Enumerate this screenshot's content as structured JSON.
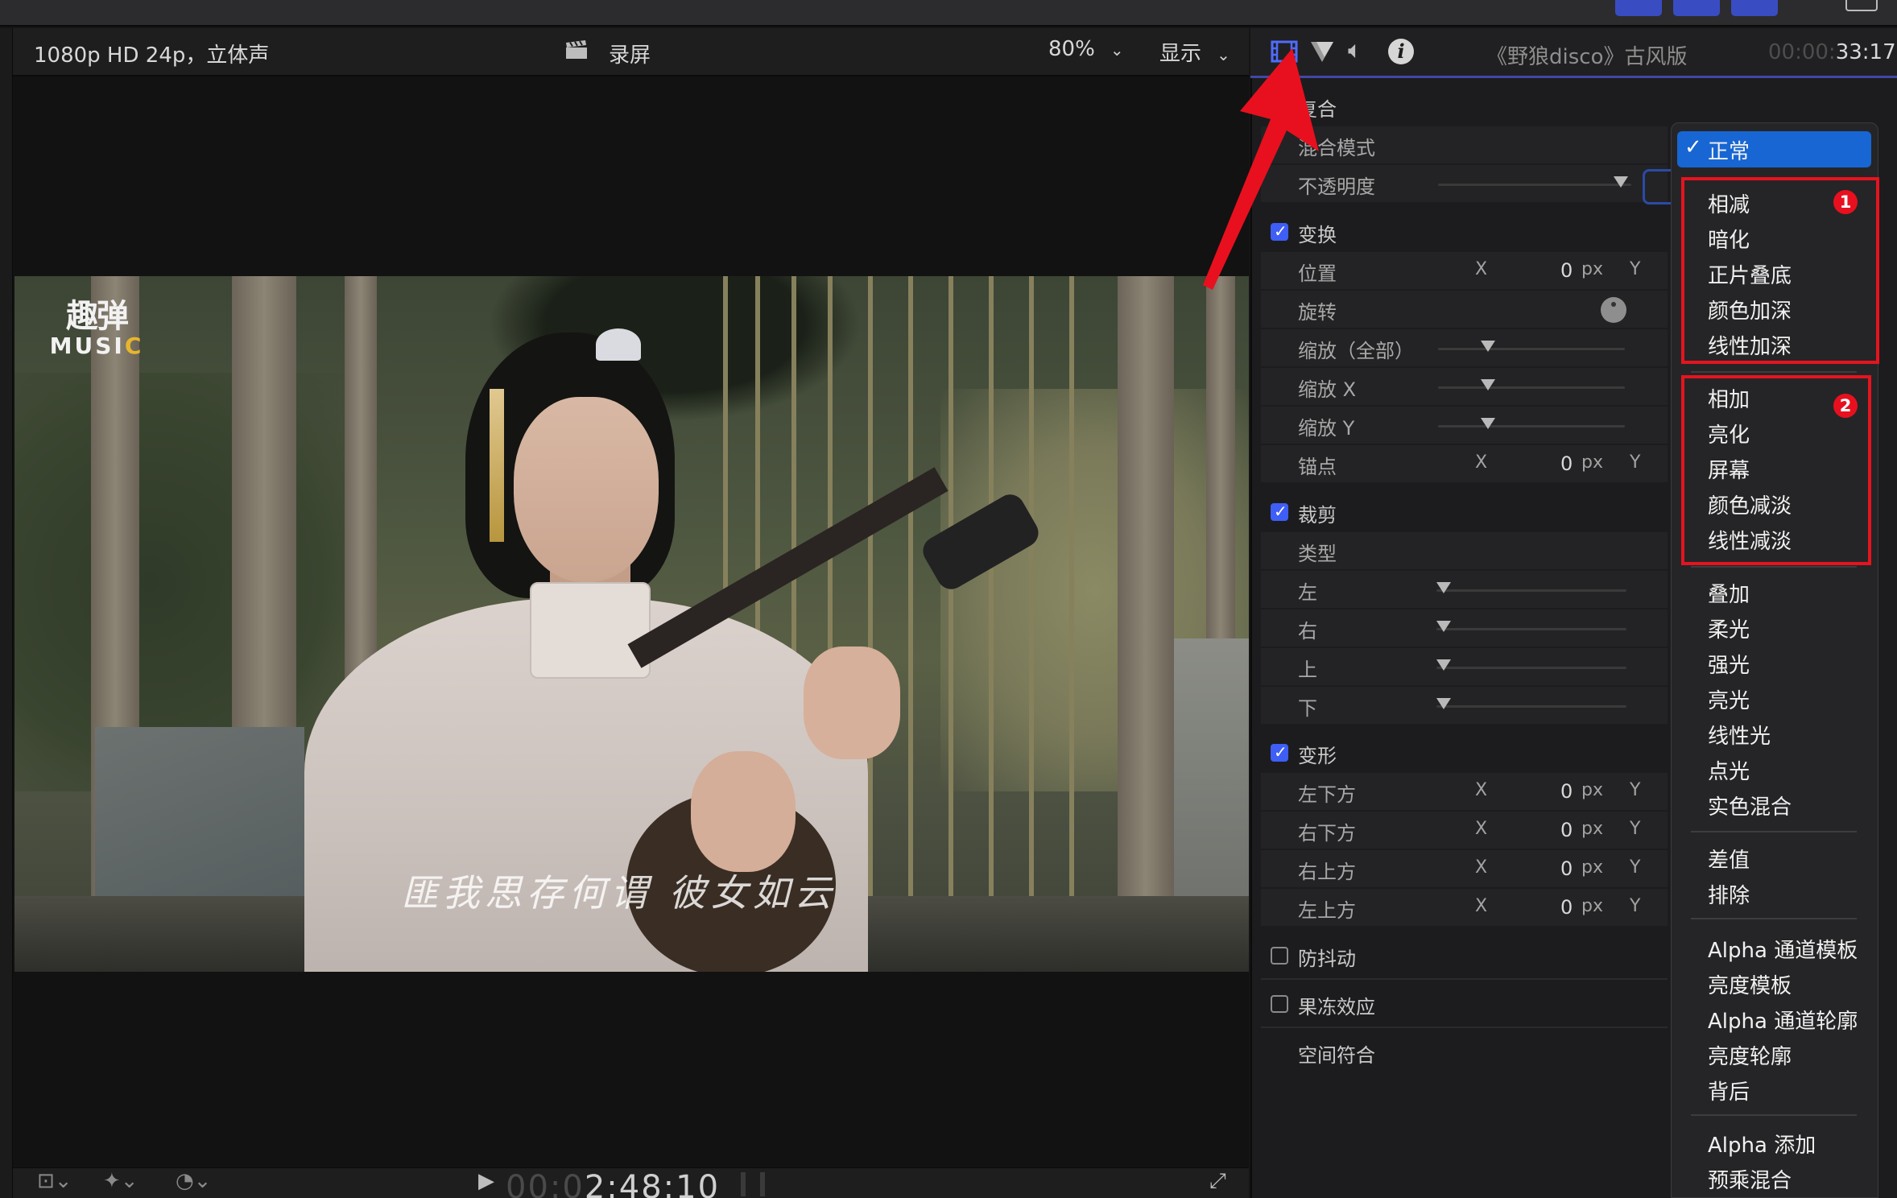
{
  "viewer": {
    "format": "1080p HD 24p，立体声",
    "title": "录屏",
    "zoom": "80%",
    "display_menu": "显示",
    "overlay_logo_line1": "趣弹",
    "overlay_logo_line2_main": "MUSI",
    "overlay_logo_line2_accent": "C",
    "subtitle": "匪我思存何谓 彼女如云",
    "timecode_dim": "00:0",
    "timecode_bright": "2:48:10"
  },
  "inspector": {
    "clip_title": "《野狼disco》古风版",
    "duration_dim": "00:00:",
    "duration_bright": "33:17",
    "compositing": {
      "title": "复合",
      "blend_mode": "混合模式",
      "opacity": "不透明度"
    },
    "transform": {
      "title": "变换",
      "position": "位置",
      "rotation": "旋转",
      "scale_all": "缩放（全部）",
      "scale_x": "缩放 X",
      "scale_y": "缩放 Y",
      "anchor": "锚点"
    },
    "crop": {
      "title": "裁剪",
      "type": "类型",
      "left": "左",
      "right": "右",
      "top": "上",
      "bottom": "下"
    },
    "distort": {
      "title": "变形",
      "bottom_left": "左下方",
      "bottom_right": "右下方",
      "top_right": "右上方",
      "top_left": "左上方"
    },
    "stabilization": "防抖动",
    "rolling_shutter": "果冻效应",
    "spatial_conform": "空间符合",
    "x": "X",
    "y": "Y",
    "zero": "0",
    "px": "px"
  },
  "blend_menu": {
    "selected": "正常",
    "group1": [
      "相减",
      "暗化",
      "正片叠底",
      "颜色加深",
      "线性加深"
    ],
    "group2": [
      "相加",
      "亮化",
      "屏幕",
      "颜色减淡",
      "线性减淡"
    ],
    "group3": [
      "叠加",
      "柔光",
      "强光",
      "亮光",
      "线性光",
      "点光",
      "实色混合"
    ],
    "group4": [
      "差值",
      "排除"
    ],
    "group5": [
      "Alpha 通道模板",
      "亮度模板",
      "Alpha 通道轮廓",
      "亮度轮廓",
      "背后"
    ],
    "group6": [
      "Alpha 添加",
      "预乘混合"
    ],
    "badge1": "1",
    "badge2": "2"
  },
  "colors": {
    "accent": "#3e5ef6",
    "selection": "#1766d3",
    "highlight_box": "#e5141f"
  }
}
